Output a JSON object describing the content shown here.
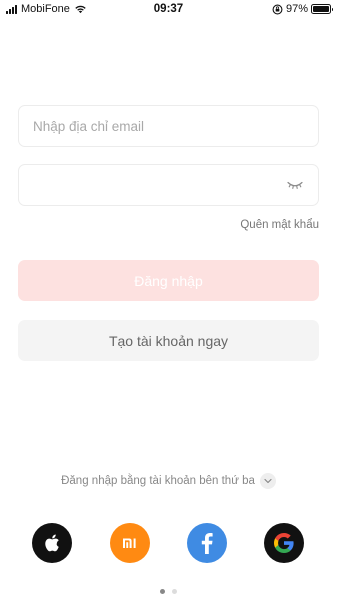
{
  "status_bar": {
    "carrier": "MobiFone",
    "time": "09:37",
    "battery": "97%",
    "battery_level": 0.97,
    "signal_bars": 4
  },
  "login": {
    "email_placeholder": "Nhập địa chỉ email",
    "email_value": "",
    "password_placeholder": "",
    "password_value": "",
    "forgot_password": "Quên mật khẩu",
    "login_button": "Đăng nhập",
    "create_account_button": "Tạo tài khoản ngay"
  },
  "third_party": {
    "label": "Đăng nhập bằng tài khoản bên thứ ba",
    "providers": [
      {
        "icon": "apple-icon",
        "color": "#111111"
      },
      {
        "icon": "xiaomi-icon",
        "color": "#ff8a12"
      },
      {
        "icon": "facebook-icon",
        "color": "#3f8be3"
      },
      {
        "icon": "google-icon",
        "color": "#111111"
      }
    ]
  },
  "pager": {
    "count": 2,
    "active_index": 0
  },
  "colors": {
    "login_button_bg": "#fde1e0",
    "accent": "#ff6b66"
  }
}
